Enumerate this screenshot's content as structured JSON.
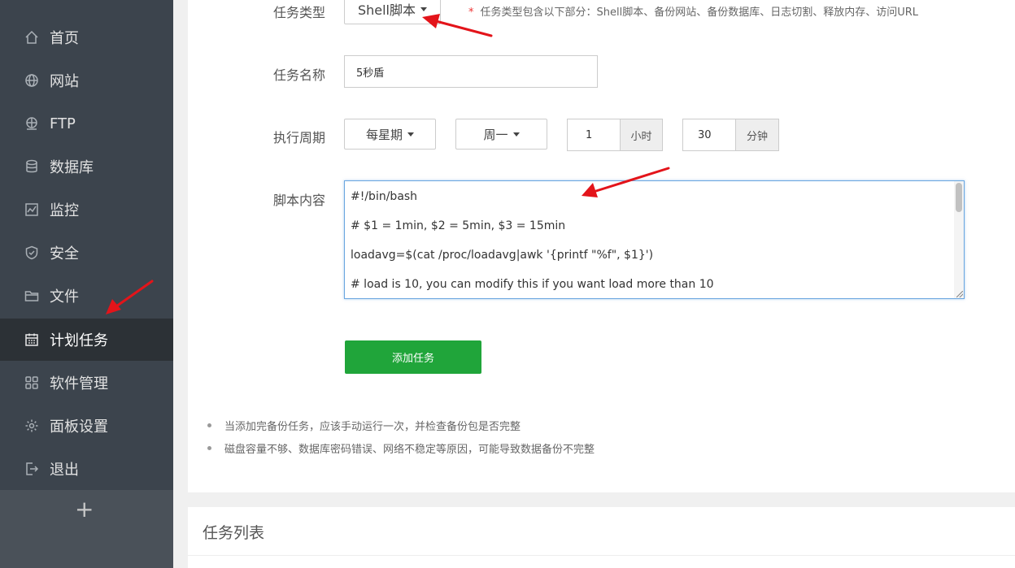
{
  "sidebar": {
    "items": [
      {
        "label": "首页",
        "icon": "home-icon"
      },
      {
        "label": "网站",
        "icon": "globe-icon"
      },
      {
        "label": "FTP",
        "icon": "ftp-icon"
      },
      {
        "label": "数据库",
        "icon": "database-icon"
      },
      {
        "label": "监控",
        "icon": "monitor-icon"
      },
      {
        "label": "安全",
        "icon": "shield-icon"
      },
      {
        "label": "文件",
        "icon": "folder-icon"
      },
      {
        "label": "计划任务",
        "icon": "calendar-icon",
        "active": true
      },
      {
        "label": "软件管理",
        "icon": "grid-icon"
      },
      {
        "label": "面板设置",
        "icon": "gear-icon"
      },
      {
        "label": "退出",
        "icon": "logout-icon"
      }
    ],
    "add_label": "+"
  },
  "form": {
    "task_type_label": "任务类型",
    "task_type_value": "Shell脚本",
    "task_type_note_star": "*",
    "task_type_note": "任务类型包含以下部分：Shell脚本、备份网站、备份数据库、日志切割、释放内存、访问URL",
    "task_name_label": "任务名称",
    "task_name_value": "5秒盾",
    "period_label": "执行周期",
    "period_value": "每星期",
    "weekday_value": "周一",
    "hour_value": "1",
    "hour_unit": "小时",
    "minute_value": "30",
    "minute_unit": "分钟",
    "script_label": "脚本内容",
    "script_lines": [
      "#!/bin/bash",
      "# $1 = 1min, $2 = 5min, $3 = 15min",
      "loadavg=$(cat /proc/loadavg|awk '{printf \"%f\", $1}')",
      "# load is 10, you can modify this if you want load more than 10"
    ],
    "submit_label": "添加任务"
  },
  "tips": [
    "当添加完备份任务，应该手动运行一次，并检查备份包是否完整",
    "磁盘容量不够、数据库密码错误、网络不稳定等原因，可能导致数据备份不完整"
  ],
  "task_list_title": "任务列表",
  "colors": {
    "sidebar_bg": "#3c444d",
    "sidebar_active_bg": "#2c3136",
    "accent_green": "#20a53a",
    "annotation_red": "#e3141a"
  }
}
